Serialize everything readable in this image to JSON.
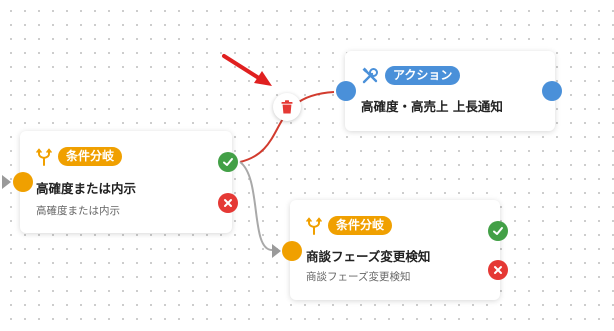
{
  "colors": {
    "condition_accent": "#f0a000",
    "action_accent": "#4a90d9",
    "yes_branch": "#43a047",
    "no_branch": "#e53935",
    "active_edge": "#d23b2e",
    "idle_edge": "#a9a9a9"
  },
  "nodes": {
    "condition_1": {
      "icon": "branch-icon",
      "badge": "条件分岐",
      "title": "高確度または内示",
      "description": "高確度または内示"
    },
    "action_1": {
      "icon": "tools-icon",
      "badge": "アクション",
      "title": "高確度・高売上 上長通知"
    },
    "condition_2": {
      "icon": "branch-icon",
      "badge": "条件分岐",
      "title": "商談フェーズ変更検知",
      "description": "商談フェーズ変更検知"
    }
  },
  "edge_toolbar": {
    "delete_icon": "trash-icon"
  },
  "annotation": {
    "icon": "red-arrow-icon"
  }
}
